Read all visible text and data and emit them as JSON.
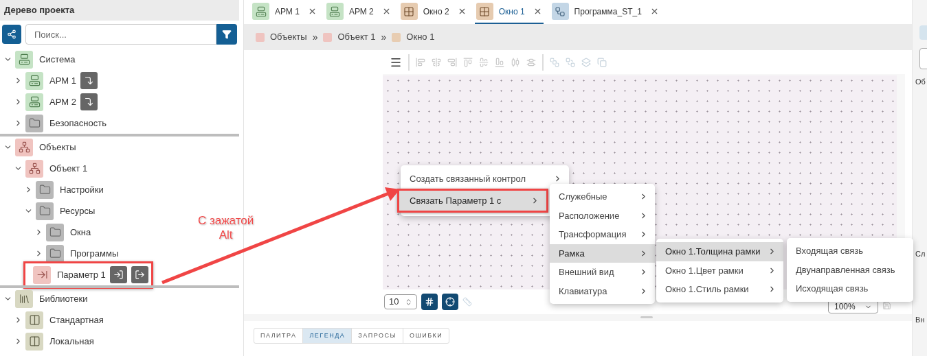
{
  "sidebar": {
    "title": "Дерево проекта",
    "search": {
      "placeholder": "Поиск..."
    },
    "sections": [
      {
        "label": "Система",
        "kind": "system",
        "expanded": true,
        "children": [
          {
            "label": "АРМ 1",
            "kind": "workstation",
            "expanded": false,
            "actions": [
              {
                "kind": "transfer"
              }
            ]
          },
          {
            "label": "АРМ 2",
            "kind": "workstation",
            "expanded": false,
            "actions": [
              {
                "kind": "transfer"
              }
            ]
          },
          {
            "label": "Безопасность",
            "kind": "folder",
            "expanded": false
          }
        ]
      },
      {
        "label": "Объекты",
        "kind": "objects",
        "expanded": true,
        "children": [
          {
            "label": "Объект 1",
            "kind": "object",
            "expanded": true,
            "children": [
              {
                "label": "Настройки",
                "kind": "folder",
                "expanded": false
              },
              {
                "label": "Ресурсы",
                "kind": "folder",
                "expanded": true,
                "children": [
                  {
                    "label": "Окна",
                    "kind": "folder",
                    "expanded": false
                  },
                  {
                    "label": "Программы",
                    "kind": "folder",
                    "expanded": false
                  }
                ]
              },
              {
                "label": "Параметр 1",
                "kind": "parameter",
                "outlined": true,
                "actions": [
                  {
                    "kind": "input"
                  },
                  {
                    "kind": "output"
                  }
                ]
              }
            ]
          }
        ]
      },
      {
        "label": "Библиотеки",
        "kind": "library",
        "expanded": true,
        "children": [
          {
            "label": "Стандартная",
            "kind": "standard",
            "expanded": false
          },
          {
            "label": "Локальная",
            "kind": "local",
            "expanded": false
          }
        ]
      }
    ]
  },
  "tabs": [
    {
      "label": "АРМ 1",
      "kind": "workstation",
      "selected": false
    },
    {
      "label": "АРМ 2",
      "kind": "workstation",
      "selected": false
    },
    {
      "label": "Окно 2",
      "kind": "window",
      "selected": false
    },
    {
      "label": "Окно 1",
      "kind": "window",
      "selected": true
    },
    {
      "label": "Программа_ST_1",
      "kind": "program",
      "selected": false
    }
  ],
  "breadcrumbs": {
    "separator": "»",
    "items": [
      {
        "label": "Объекты",
        "color": "#efc4c0"
      },
      {
        "label": "Объект 1",
        "color": "#efc4c0"
      },
      {
        "label": "Окно 1",
        "color": "#e8cdb2"
      }
    ]
  },
  "editor": {
    "grid_step": "10",
    "grid_on": true,
    "snap_on": true,
    "zoom": "100%"
  },
  "bottom_tabs": [
    {
      "label": "ПАЛИТРА",
      "selected": false
    },
    {
      "label": "ЛЕГЕНДА",
      "selected": true
    },
    {
      "label": "ЗАПРОСЫ",
      "selected": false
    },
    {
      "label": "ОШИБКИ",
      "selected": false
    }
  ],
  "context_menu": {
    "levels": [
      {
        "items": [
          {
            "label": "Создать связанный контрол",
            "selected": false,
            "outlined": false
          },
          {
            "label": "Связать Параметр 1 с",
            "selected": true,
            "outlined": true
          }
        ]
      },
      {
        "items": [
          {
            "label": "Служебные",
            "selected": false
          },
          {
            "label": "Расположение",
            "selected": false
          },
          {
            "label": "Трансформация",
            "selected": false
          },
          {
            "label": "Рамка",
            "selected": true
          },
          {
            "label": "Внешний вид",
            "selected": false
          },
          {
            "label": "Клавиатура",
            "selected": false
          }
        ]
      },
      {
        "items": [
          {
            "label": "Окно 1.Толщина рамки",
            "selected": true
          },
          {
            "label": "Окно 1.Цвет рамки",
            "selected": false
          },
          {
            "label": "Окно 1.Стиль рамки",
            "selected": false
          }
        ]
      },
      {
        "items": [
          {
            "label": "Входящая связь",
            "selected": false,
            "submenu": false
          },
          {
            "label": "Двунаправленная связь",
            "selected": false,
            "submenu": false
          },
          {
            "label": "Исходящая связь",
            "selected": false,
            "submenu": false
          }
        ]
      }
    ]
  },
  "annotation": {
    "lines": [
      "С зажатой",
      "Alt"
    ]
  },
  "right_panel": {
    "labels": [
      "Об",
      "Сл",
      "Вн"
    ]
  }
}
